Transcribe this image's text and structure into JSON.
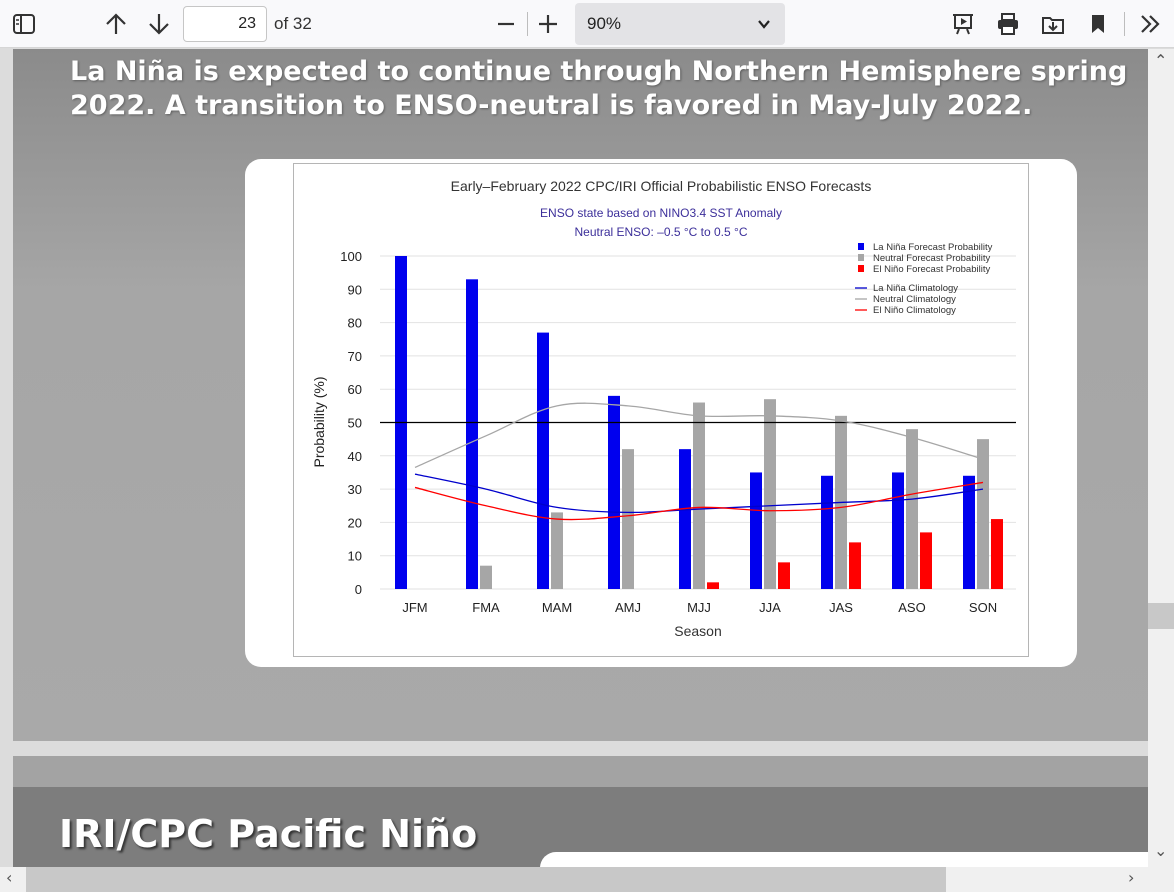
{
  "toolbar": {
    "page_number": "23",
    "page_total": "of 32",
    "zoom": "90%"
  },
  "slide1": {
    "title": "La Niña is expected to continue through Northern Hemisphere spring 2022.  A transition to ENSO-neutral is favored in May-July 2022."
  },
  "slide2": {
    "title": "IRI/CPC Pacific Niño"
  },
  "chart_data": {
    "type": "bar",
    "title": "Early–February 2022 CPC/IRI Official Probabilistic ENSO Forecasts",
    "subtitle": [
      "ENSO state based on NINO3.4 SST Anomaly",
      "Neutral ENSO: –0.5 °C to 0.5 °C"
    ],
    "xlabel": "Season",
    "ylabel": "Probability (%)",
    "ylim": [
      0,
      100
    ],
    "yticks": [
      0,
      10,
      20,
      30,
      40,
      50,
      60,
      70,
      80,
      90,
      100
    ],
    "categories": [
      "JFM",
      "FMA",
      "MAM",
      "AMJ",
      "MJJ",
      "JJA",
      "JAS",
      "ASO",
      "SON"
    ],
    "series": [
      {
        "name": "La Niña Forecast Probability",
        "kind": "bar",
        "color": "#0000ee",
        "values": [
          100,
          93,
          77,
          58,
          42,
          35,
          34,
          35,
          34
        ]
      },
      {
        "name": "Neutral Forecast Probability",
        "kind": "bar",
        "color": "#a6a6a6",
        "values": [
          0,
          7,
          23,
          42,
          56,
          57,
          52,
          48,
          45
        ]
      },
      {
        "name": "El Niño Forecast Probability",
        "kind": "bar",
        "color": "#ff0000",
        "values": [
          0,
          0,
          0,
          0,
          2,
          8,
          14,
          17,
          21
        ]
      },
      {
        "name": "La Niña Climatology",
        "kind": "line",
        "color": "#0000cc",
        "values": [
          34.5,
          30,
          24.5,
          23,
          24,
          25,
          26,
          27,
          30
        ]
      },
      {
        "name": "Neutral Climatology",
        "kind": "line",
        "color": "#a6a6a6",
        "values": [
          36.5,
          46,
          55,
          55,
          52,
          52,
          50.5,
          45.5,
          39
        ]
      },
      {
        "name": "El Niño Climatology",
        "kind": "line",
        "color": "#ff0000",
        "values": [
          30.5,
          25,
          21,
          22,
          24.5,
          23.5,
          24.5,
          28.5,
          32
        ]
      }
    ],
    "reference_line": 50,
    "legend_position": "top-right"
  }
}
